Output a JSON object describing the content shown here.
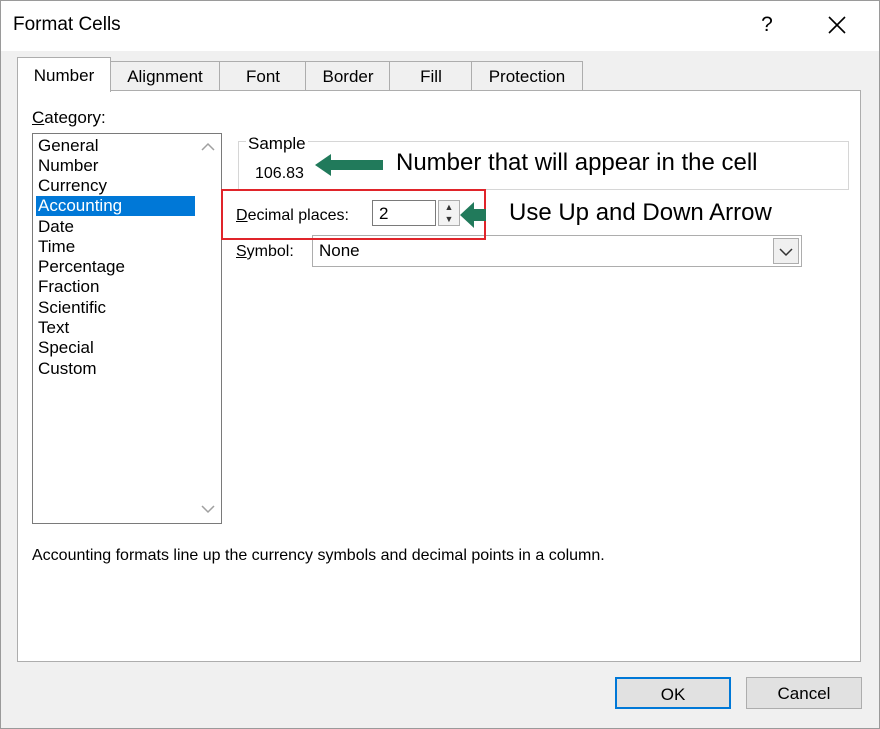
{
  "window": {
    "title": "Format Cells",
    "help_label": "?",
    "close_label": "✕"
  },
  "tabs": [
    {
      "label": "Number",
      "active": true
    },
    {
      "label": "Alignment"
    },
    {
      "label": "Font"
    },
    {
      "label": "Border"
    },
    {
      "label": "Fill"
    },
    {
      "label": "Protection"
    }
  ],
  "category": {
    "label_first": "C",
    "label_rest": "ategory:",
    "items": [
      "General",
      "Number",
      "Currency",
      "Accounting",
      "Date",
      "Time",
      "Percentage",
      "Fraction",
      "Scientific",
      "Text",
      "Special",
      "Custom"
    ],
    "selected": "Accounting"
  },
  "sample": {
    "label": "Sample",
    "value": "106.83"
  },
  "decimal_places": {
    "label_first": "D",
    "label_rest": "ecimal places:",
    "value": "2"
  },
  "symbol": {
    "label_first": "S",
    "label_rest": "ymbol:",
    "value": "None"
  },
  "description": "Accounting formats line up the currency symbols and decimal points in a column.",
  "buttons": {
    "ok": "OK",
    "cancel": "Cancel"
  },
  "annotations": {
    "sample_note": "Number that will appear in the cell",
    "spinner_note": "Use Up and Down Arrow",
    "arrow_color": "#217a5b",
    "highlight_color": "#e0242a"
  }
}
